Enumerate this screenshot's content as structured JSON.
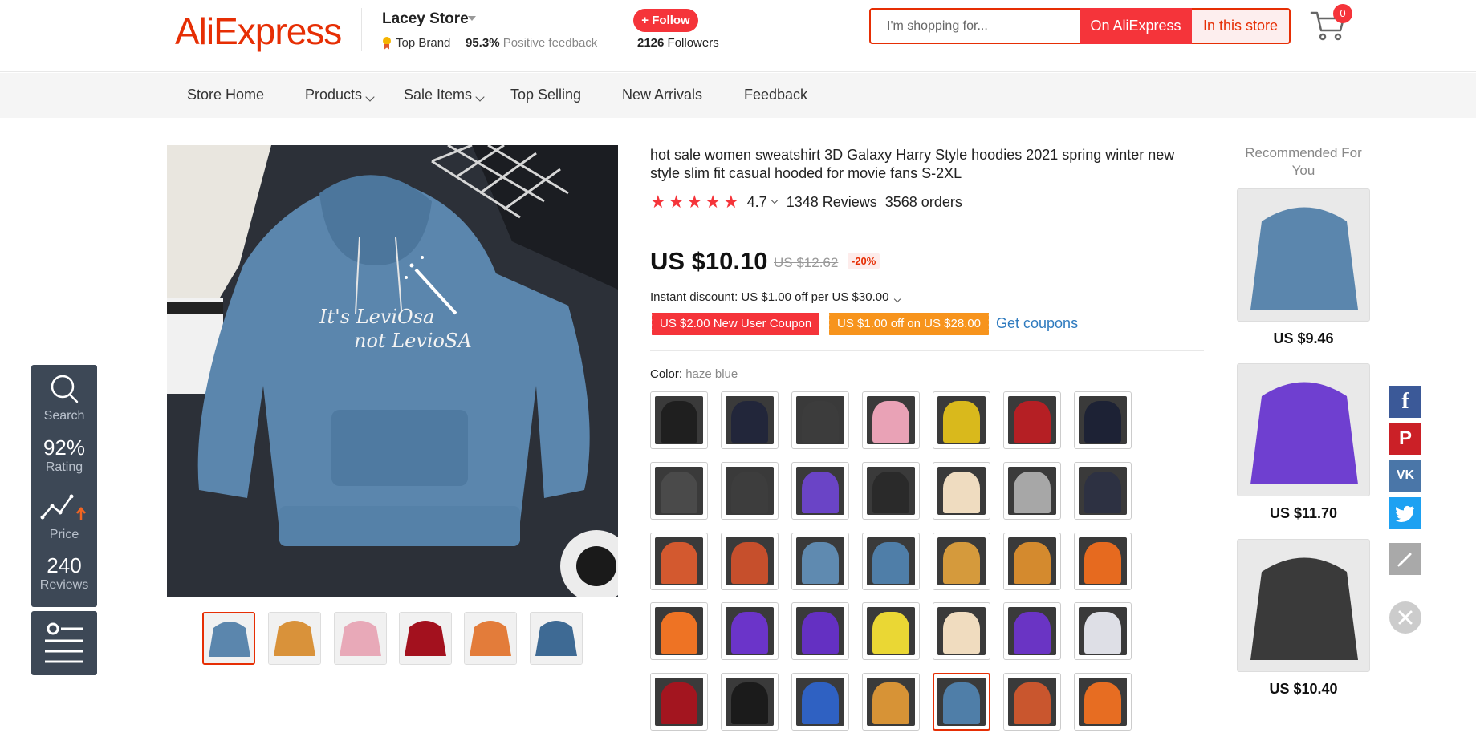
{
  "header": {
    "logo": "AliExpress",
    "store_name": "Lacey Store",
    "top_brand": "Top Brand",
    "positive_pct": "95.3%",
    "positive_label": "Positive feedback",
    "follow_label": "+ Follow",
    "followers_count": "2126",
    "followers_label": "Followers",
    "search_placeholder": "I'm shopping for...",
    "btn_on_aliexpress": "On AliExpress",
    "btn_in_store": "In this store",
    "cart_count": "0"
  },
  "nav": {
    "items": [
      {
        "label": "Store Home",
        "dropdown": false
      },
      {
        "label": "Products",
        "dropdown": true
      },
      {
        "label": "Sale Items",
        "dropdown": true
      },
      {
        "label": "Top Selling",
        "dropdown": false
      },
      {
        "label": "New Arrivals",
        "dropdown": false
      },
      {
        "label": "Feedback",
        "dropdown": false
      }
    ]
  },
  "gallery": {
    "main_print_line1": "It's LeviOsa",
    "main_print_line2": "not LevioSA",
    "thumb_colors": [
      "#5b86ad",
      "#d9923a",
      "#e8a9b8",
      "#a3111e",
      "#e37c3a",
      "#3e6a94"
    ]
  },
  "product": {
    "title": "hot sale women sweatshirt 3D Galaxy Harry Style hoodies 2021 spring winter new style slim fit casual hooded for movie fans S-2XL",
    "rating": "4.7",
    "reviews": "1348 Reviews",
    "orders": "3568 orders",
    "price": "US $10.10",
    "old_price": "US $12.62",
    "discount": "-20%",
    "instant_discount": "Instant discount: US $1.00 off per US $30.00",
    "coupon1": "US $2.00 New User Coupon",
    "coupon2": "US $1.00 off on US $28.00",
    "get_coupons": "Get coupons",
    "color_label": "Color:",
    "color_value": "haze blue",
    "swatches": [
      "#1f1f1f",
      "#22263a",
      "#3c3c3c",
      "#e9a2b6",
      "#d9b91c",
      "#b51f24",
      "#1d2235",
      "#4a4a4a",
      "#3d3d3d",
      "#6a44c6",
      "#2a2a2a",
      "#efdcc0",
      "#a7a7a7",
      "#2d3142",
      "#d3592f",
      "#c64f2c",
      "#5f8ab0",
      "#4f7ea8",
      "#d59a3c",
      "#d48a2e",
      "#e66a1f",
      "#ee7324",
      "#6b34c9",
      "#6430c2",
      "#ead734",
      "#f0dcbf",
      "#6a34c4",
      "#dedfe6",
      "#a3151f",
      "#1b1b1b",
      "#2f61c2",
      "#d79336",
      "#4f7ea8",
      "#c9562e",
      "#e76d22"
    ],
    "selected_swatch_index": 32
  },
  "recommended": {
    "title": "Recommended For You",
    "items": [
      {
        "price": "US $9.46",
        "color": "#5b86ad"
      },
      {
        "price": "US $11.70",
        "color": "#6f3fd0"
      },
      {
        "price": "US $10.40",
        "color": "#3a3a3a"
      }
    ]
  },
  "side_panel": {
    "search": "Search",
    "rating_value": "92%",
    "rating_label": "Rating",
    "price_label": "Price",
    "reviews_value": "240",
    "reviews_label": "Reviews"
  },
  "share": {
    "facebook": "f",
    "pinterest": "P",
    "vk": "VK",
    "colors": {
      "facebook": "#3b5998",
      "pinterest": "#cb2027",
      "vk": "#4a76a8",
      "twitter": "#1da1f2",
      "edit": "#a9a9a9"
    }
  }
}
